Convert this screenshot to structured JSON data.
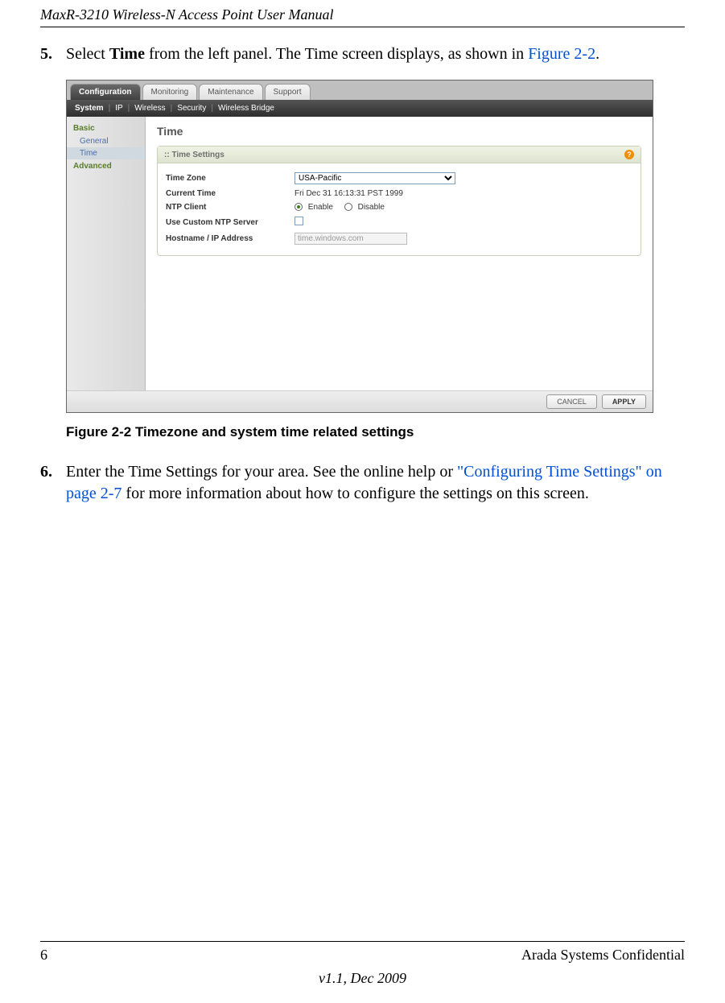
{
  "header": {
    "title": "MaxR-3210 Wireless-N Access Point User Manual"
  },
  "step5": {
    "num": "5.",
    "pre": "Select ",
    "bold": "Time",
    "post": " from the left panel. The Time screen displays, as shown in ",
    "link": "Figure 2-2",
    "end": "."
  },
  "screenshot": {
    "tabs": [
      "Configuration",
      "Monitoring",
      "Maintenance",
      "Support"
    ],
    "subnav": [
      "System",
      "IP",
      "Wireless",
      "Security",
      "Wireless Bridge"
    ],
    "sidebar": {
      "cat1": "Basic",
      "sub1": "General",
      "sub2": "Time",
      "cat2": "Advanced"
    },
    "heading": "Time",
    "panel": {
      "title": ":: Time Settings",
      "rows": {
        "tz_label": "Time Zone",
        "tz_value": "USA-Pacific",
        "ct_label": "Current Time",
        "ct_value": "Fri Dec 31 16:13:31 PST 1999",
        "ntp_label": "NTP Client",
        "ntp_enable": "Enable",
        "ntp_disable": "Disable",
        "custom_label": "Use Custom NTP Server",
        "host_label": "Hostname / IP Address",
        "host_value": "time.windows.com"
      }
    },
    "buttons": {
      "cancel": "CANCEL",
      "apply": "APPLY"
    }
  },
  "figure_caption": "Figure 2-2  Timezone and system time related settings",
  "step6": {
    "num": "6.",
    "pre": "Enter the Time Settings for your area. See the online help or ",
    "link": "\"Configuring Time Settings\" on page 2-7",
    "post": " for more information about how to configure the settings on this screen."
  },
  "footer": {
    "page": "6",
    "conf": "Arada Systems Confidential",
    "ver": "v1.1, Dec 2009"
  }
}
